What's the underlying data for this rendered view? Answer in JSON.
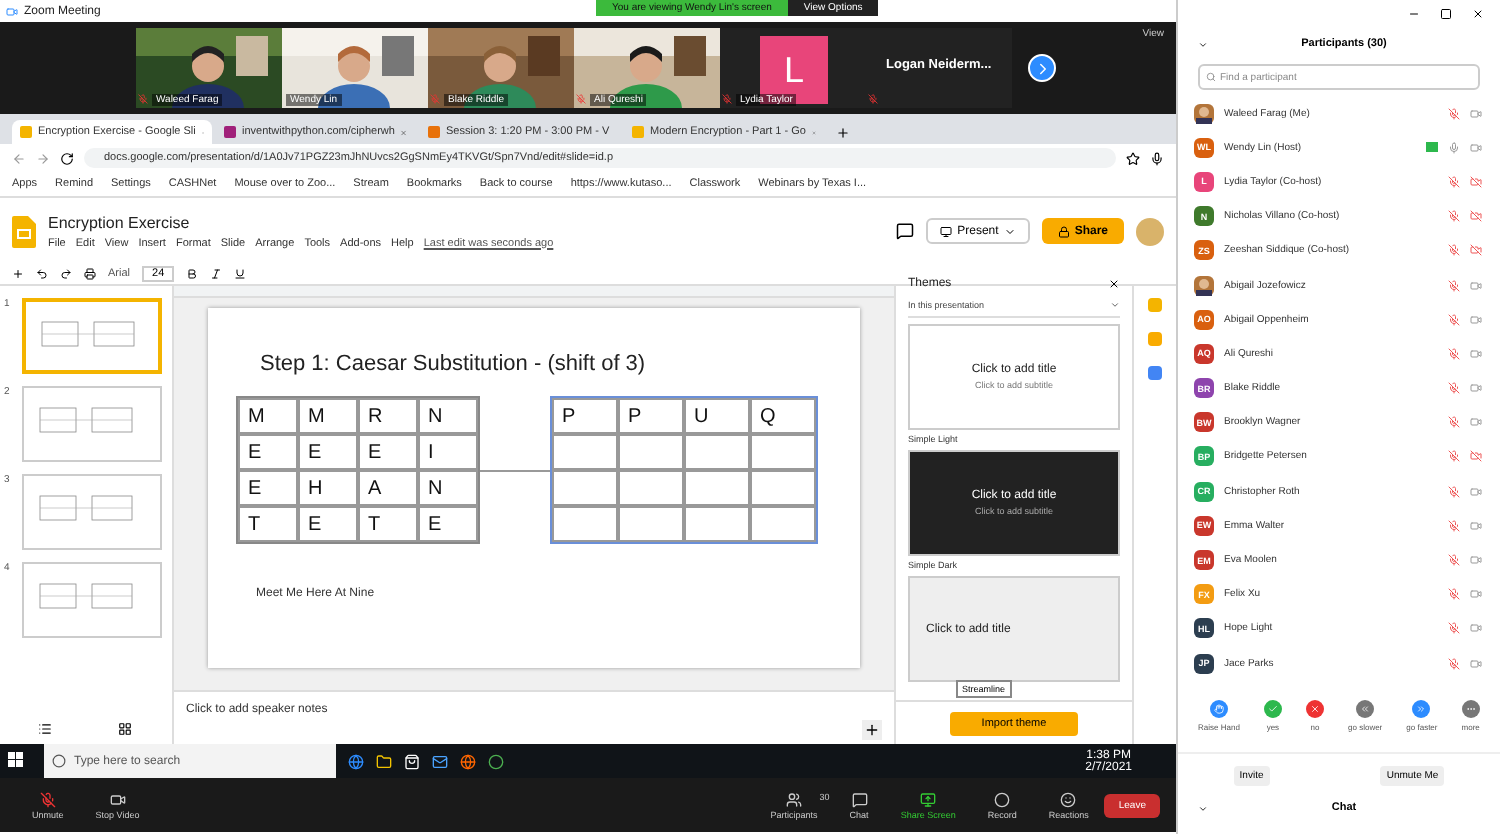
{
  "zoom_window": {
    "title": "Zoom Meeting",
    "banner": "You are viewing Wendy Lin's screen",
    "view_options": "View Options"
  },
  "video_strip": {
    "view_label": "View",
    "tiles": [
      {
        "kind": "video",
        "name": "Waleed Farag",
        "muted": true
      },
      {
        "kind": "video",
        "name": "Wendy Lin",
        "muted": false
      },
      {
        "kind": "video",
        "name": "Blake Riddle",
        "muted": true
      },
      {
        "kind": "video",
        "name": "Ali Qureshi",
        "muted": true
      },
      {
        "kind": "avatar",
        "name": "Lydia Taylor",
        "initial": "L",
        "color": "#e8457a",
        "muted": true
      },
      {
        "kind": "name",
        "name": "Logan  Neiderm...",
        "muted": true
      }
    ]
  },
  "browser": {
    "tabs": [
      {
        "title": "Encryption Exercise - Google Sli",
        "selected": true,
        "color": "#f4b400"
      },
      {
        "title": "inventwithpython.com/cipherwh",
        "selected": false,
        "color": "#a0207a"
      },
      {
        "title": "Session 3: 1:20 PM - 3:00 PM - V",
        "selected": false,
        "color": "#e8710a"
      },
      {
        "title": "Modern Encryption - Part 1 - Go",
        "selected": false,
        "color": "#f4b400"
      }
    ],
    "url": "docs.google.com/presentation/d/1A0Jv71PGZ23mJhNUvcs2GgSNmEy4TKVGt/Spn7Vnd/edit#slide=id.p",
    "bookmarks": [
      "Apps",
      "Remind",
      "Settings",
      "CASHNet",
      "Mouse over to Zoo...",
      "Stream",
      "Bookmarks",
      "Back to course",
      "https://www.kutaso...",
      "Classwork",
      "Webinars by Texas I..."
    ]
  },
  "slides_app": {
    "title": "Encryption Exercise",
    "menu": [
      "File",
      "Edit",
      "View",
      "Insert",
      "Format",
      "Slide",
      "Arrange",
      "Tools",
      "Add-ons",
      "Help"
    ],
    "last_edit": "Last edit was seconds ago",
    "present": "Present",
    "share": "Share",
    "font": "Arial",
    "font_size": "24",
    "thumbnails": [
      {
        "number": "1",
        "selected": true
      },
      {
        "number": "2",
        "selected": false
      },
      {
        "number": "3",
        "selected": false
      },
      {
        "number": "4",
        "selected": false
      }
    ],
    "slide": {
      "title": "Step 1: Caesar Substitution - (shift of 3)",
      "left_table": [
        [
          "M",
          "M",
          "R",
          "N"
        ],
        [
          "E",
          "E",
          "E",
          "I"
        ],
        [
          "E",
          "H",
          "A",
          "N"
        ],
        [
          "T",
          "E",
          "T",
          "E"
        ]
      ],
      "right_table": [
        [
          "P",
          "P",
          "U",
          "Q"
        ]
      ],
      "footer": "Meet Me Here At Nine"
    },
    "speaker_notes": "Click to add speaker notes",
    "themes": {
      "title": "Themes",
      "filter": "In this presentation",
      "items": [
        {
          "kind": "light",
          "name": "Simple Light",
          "heading": "Click to add title",
          "subheading": "Click to add subtitle"
        },
        {
          "kind": "dark",
          "name": "Simple Dark",
          "heading": "Click to add title",
          "subheading": "Click to add subtitle"
        },
        {
          "kind": "streamline",
          "heading": "Click to add title"
        }
      ],
      "tooltip": "Streamline",
      "import_button": "Import theme"
    }
  },
  "taskbar": {
    "search_placeholder": "Type here to search",
    "time": "1:38 PM",
    "date": "2/7/2021"
  },
  "zoom_controls": [
    {
      "kind": "mic",
      "label": "Unmute"
    },
    {
      "kind": "video",
      "label": "Stop Video"
    },
    {
      "kind": "participants",
      "label": "Participants",
      "count": "30"
    },
    {
      "kind": "chat",
      "label": "Chat"
    },
    {
      "kind": "share",
      "label": "Share Screen"
    },
    {
      "kind": "record",
      "label": "Record"
    },
    {
      "kind": "reactions",
      "label": "Reactions"
    }
  ],
  "leave": "Leave",
  "participants_panel": {
    "title": "Participants (30)",
    "search_placeholder": "Find a participant",
    "people": [
      {
        "name": "Waleed Farag (Me)",
        "muted": true,
        "video_off": false,
        "sharing": false
      },
      {
        "name": "Wendy Lin (Host)",
        "kind": "initials",
        "initials": "WL",
        "color": "#d9600f",
        "muted": false,
        "video_off": false,
        "sharing": true
      },
      {
        "name": "Lydia Taylor (Co-host)",
        "kind": "initials",
        "initials": "L",
        "color": "#e8457a",
        "muted": true,
        "video_off": true,
        "sharing": false
      },
      {
        "name": "Nicholas Villano (Co-host)",
        "kind": "initials",
        "initials": "N",
        "color": "#3f7a2c",
        "muted": true,
        "video_off": true,
        "sharing": false
      },
      {
        "name": "Zeeshan Siddique (Co-host)",
        "kind": "initials",
        "initials": "ZS",
        "color": "#d9600f",
        "muted": true,
        "video_off": true,
        "sharing": false
      },
      {
        "name": "Abigail Jozefowicz",
        "muted": true,
        "video_off": false,
        "sharing": false
      },
      {
        "name": "Abigail Oppenheim",
        "kind": "initials",
        "initials": "AO",
        "color": "#d9600f",
        "muted": true,
        "video_off": false,
        "sharing": false
      },
      {
        "name": "Ali Qureshi",
        "kind": "initials",
        "initials": "AQ",
        "color": "#c9372c",
        "muted": true,
        "video_off": false,
        "sharing": false
      },
      {
        "name": "Blake Riddle",
        "kind": "initials",
        "initials": "BR",
        "color": "#8e44ad",
        "muted": true,
        "video_off": false,
        "sharing": false
      },
      {
        "name": "Brooklyn Wagner",
        "kind": "initials",
        "initials": "BW",
        "color": "#c9372c",
        "muted": true,
        "video_off": false,
        "sharing": false
      },
      {
        "name": "Bridgette Petersen",
        "kind": "initials",
        "initials": "BP",
        "color": "#27ae60",
        "muted": true,
        "video_off": true,
        "sharing": false
      },
      {
        "name": "Christopher Roth",
        "kind": "initials",
        "initials": "CR",
        "color": "#27ae60",
        "muted": true,
        "video_off": false,
        "sharing": false
      },
      {
        "name": "Emma Walter",
        "kind": "initials",
        "initials": "EW",
        "color": "#c9372c",
        "muted": true,
        "video_off": false,
        "sharing": false
      },
      {
        "name": "Eva Moolen",
        "kind": "initials",
        "initials": "EM",
        "color": "#c9372c",
        "muted": true,
        "video_off": false,
        "sharing": false
      },
      {
        "name": "Felix Xu",
        "kind": "initials",
        "initials": "FX",
        "color": "#f39c12",
        "muted": true,
        "video_off": false,
        "sharing": false
      },
      {
        "name": "Hope Light",
        "kind": "initials",
        "initials": "HL",
        "color": "#2c3e50",
        "muted": true,
        "video_off": false,
        "sharing": false
      },
      {
        "name": "Jace Parks",
        "kind": "initials",
        "initials": "JP",
        "color": "#2c3e50",
        "muted": true,
        "video_off": false,
        "sharing": false
      }
    ],
    "reactions": [
      {
        "kind": "hand",
        "label": "Raise Hand"
      },
      {
        "kind": "yes",
        "label": "yes"
      },
      {
        "kind": "no",
        "label": "no"
      },
      {
        "kind": "slower",
        "label": "go slower"
      },
      {
        "kind": "faster",
        "label": "go faster"
      },
      {
        "kind": "more",
        "label": "more"
      }
    ],
    "buttons": [
      "Invite",
      "Unmute Me"
    ],
    "chat": "Chat"
  }
}
